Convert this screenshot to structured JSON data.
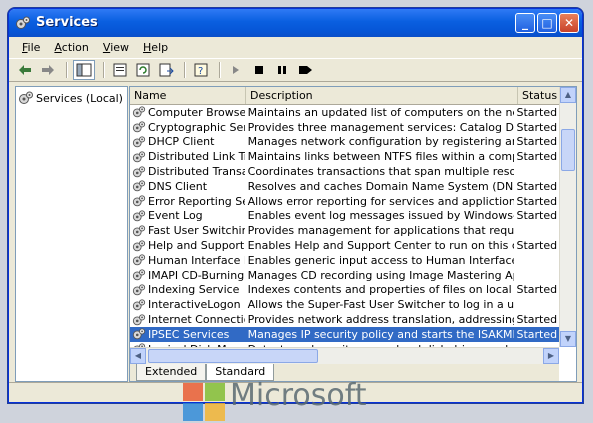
{
  "window": {
    "title": "Services"
  },
  "menu": [
    {
      "underline": "F",
      "rest": "ile"
    },
    {
      "underline": "A",
      "rest": "ction"
    },
    {
      "underline": "V",
      "rest": "iew"
    },
    {
      "underline": "H",
      "rest": "elp"
    }
  ],
  "tree": {
    "root_label": "Services (Local)"
  },
  "columns": {
    "name": "Name",
    "description": "Description",
    "status": "Status"
  },
  "services": [
    {
      "name": "Computer Browser",
      "description": "Maintains an updated list of computers on the network and...",
      "status": "Started"
    },
    {
      "name": "Cryptographic Servi...",
      "description": "Provides three management services: Catalog Database S...",
      "status": "Started"
    },
    {
      "name": "DHCP Client",
      "description": "Manages network configuration by registering and updatin...",
      "status": "Started"
    },
    {
      "name": "Distributed Link Tra...",
      "description": "Maintains links between NTFS files within a computer or acr...",
      "status": "Started"
    },
    {
      "name": "Distributed Transac...",
      "description": "Coordinates transactions that span multiple resource mana...",
      "status": ""
    },
    {
      "name": "DNS Client",
      "description": "Resolves and caches Domain Name System (DNS) names f...",
      "status": "Started"
    },
    {
      "name": "Error Reporting Ser...",
      "description": "Allows error reporting for services and applictions running i...",
      "status": "Started"
    },
    {
      "name": "Event Log",
      "description": "Enables event log messages issued by Windows-based pro...",
      "status": "Started"
    },
    {
      "name": "Fast User Switching...",
      "description": "Provides management for applications that require assista...",
      "status": ""
    },
    {
      "name": "Help and Support",
      "description": "Enables Help and Support Center to run on this computer....",
      "status": "Started"
    },
    {
      "name": "Human Interface D...",
      "description": "Enables generic input access to Human Interface Devices (...",
      "status": ""
    },
    {
      "name": "IMAPI CD-Burning C...",
      "description": "Manages CD recording using Image Mastering Applications ...",
      "status": ""
    },
    {
      "name": "Indexing Service",
      "description": "Indexes contents and properties of files on local and remot...",
      "status": "Started"
    },
    {
      "name": "InteractiveLogon",
      "description": "Allows the Super-Fast User Switcher to log in a user",
      "status": ""
    },
    {
      "name": "Internet Connectio...",
      "description": "Provides network address translation, addressing, name re...",
      "status": "Started"
    },
    {
      "name": "IPSEC Services",
      "description": "Manages IP security policy and starts the ISAKMP/Oakley (...",
      "status": "Started",
      "selected": true
    },
    {
      "name": "Logical Disk Manager",
      "description": "Detects and monitors new hard disk drives and sends disk ...",
      "status": ""
    }
  ],
  "tabs": {
    "extended": "Extended",
    "standard": "Standard"
  },
  "watermark": {
    "brand": "Microsoft"
  },
  "colors": {
    "selection": "#316ac5",
    "titlebar": "#0a5fe0"
  }
}
